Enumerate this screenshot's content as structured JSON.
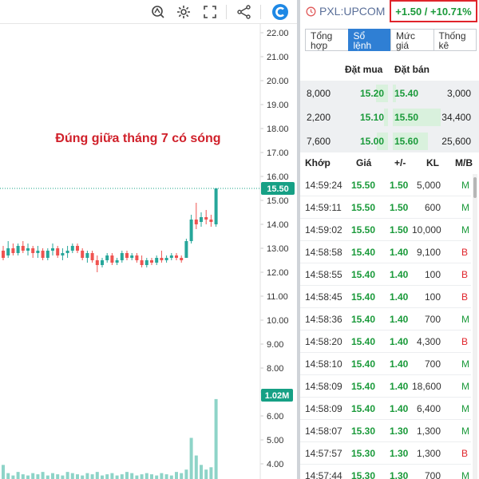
{
  "toolbar": {
    "icons": [
      "compare-icon",
      "settings-icon",
      "fullscreen-icon",
      "share-icon",
      "app-logo-icon"
    ]
  },
  "chart": {
    "annotation": "Đúng giữa tháng 7 có sóng",
    "annotation_color": "#d0202a",
    "last_price_label": "15.50",
    "volume_label": "1.02M",
    "up_color": "#26a69a",
    "down_color": "#ef5350",
    "volume_color": "#8ed4c8",
    "label_color": "#16a085"
  },
  "chart_data": {
    "type": "candlestick",
    "price_axis_ticks": [
      "22.00",
      "21.00",
      "20.00",
      "19.00",
      "18.00",
      "17.00",
      "16.00",
      "15.00",
      "14.00",
      "13.00",
      "12.00",
      "11.00",
      "10.00",
      "9.00",
      "8.00",
      "7.00",
      "6.00",
      "5.00",
      "4.00"
    ],
    "price_range": [
      3.6,
      22.4
    ],
    "last_price": 15.5,
    "candles": [
      {
        "o": 12.9,
        "h": 13.1,
        "l": 12.5,
        "c": 12.6
      },
      {
        "o": 12.7,
        "h": 13.3,
        "l": 12.6,
        "c": 13.0
      },
      {
        "o": 13.0,
        "h": 13.2,
        "l": 12.7,
        "c": 12.8
      },
      {
        "o": 12.8,
        "h": 13.2,
        "l": 12.7,
        "c": 13.1
      },
      {
        "o": 13.1,
        "h": 13.3,
        "l": 12.8,
        "c": 12.9
      },
      {
        "o": 12.9,
        "h": 13.2,
        "l": 12.7,
        "c": 13.0
      },
      {
        "o": 13.0,
        "h": 13.1,
        "l": 12.6,
        "c": 12.8
      },
      {
        "o": 12.8,
        "h": 13.1,
        "l": 12.6,
        "c": 12.9
      },
      {
        "o": 12.9,
        "h": 13.0,
        "l": 12.5,
        "c": 12.6
      },
      {
        "o": 12.6,
        "h": 13.0,
        "l": 12.5,
        "c": 12.9
      },
      {
        "o": 12.9,
        "h": 13.2,
        "l": 12.7,
        "c": 13.0
      },
      {
        "o": 13.0,
        "h": 13.1,
        "l": 12.6,
        "c": 12.7
      },
      {
        "o": 12.7,
        "h": 13.0,
        "l": 12.5,
        "c": 12.8
      },
      {
        "o": 12.8,
        "h": 13.1,
        "l": 12.6,
        "c": 12.9
      },
      {
        "o": 12.9,
        "h": 13.2,
        "l": 12.8,
        "c": 13.1
      },
      {
        "o": 13.1,
        "h": 13.2,
        "l": 12.8,
        "c": 12.9
      },
      {
        "o": 12.9,
        "h": 13.0,
        "l": 12.5,
        "c": 12.6
      },
      {
        "o": 12.6,
        "h": 12.9,
        "l": 12.4,
        "c": 12.8
      },
      {
        "o": 12.8,
        "h": 12.9,
        "l": 12.4,
        "c": 12.5
      },
      {
        "o": 12.5,
        "h": 12.7,
        "l": 12.0,
        "c": 12.3
      },
      {
        "o": 12.3,
        "h": 12.6,
        "l": 12.2,
        "c": 12.5
      },
      {
        "o": 12.5,
        "h": 12.8,
        "l": 12.4,
        "c": 12.7
      },
      {
        "o": 12.7,
        "h": 12.8,
        "l": 12.3,
        "c": 12.4
      },
      {
        "o": 12.4,
        "h": 12.6,
        "l": 12.3,
        "c": 12.5
      },
      {
        "o": 12.5,
        "h": 12.9,
        "l": 12.4,
        "c": 12.8
      },
      {
        "o": 12.8,
        "h": 12.9,
        "l": 12.5,
        "c": 12.6
      },
      {
        "o": 12.6,
        "h": 12.8,
        "l": 12.5,
        "c": 12.7
      },
      {
        "o": 12.7,
        "h": 12.8,
        "l": 12.4,
        "c": 12.5
      },
      {
        "o": 12.5,
        "h": 12.7,
        "l": 12.2,
        "c": 12.3
      },
      {
        "o": 12.3,
        "h": 12.6,
        "l": 12.2,
        "c": 12.5
      },
      {
        "o": 12.5,
        "h": 12.6,
        "l": 12.3,
        "c": 12.4
      },
      {
        "o": 12.4,
        "h": 12.7,
        "l": 12.3,
        "c": 12.6
      },
      {
        "o": 12.6,
        "h": 12.9,
        "l": 12.4,
        "c": 12.5
      },
      {
        "o": 12.5,
        "h": 12.7,
        "l": 12.4,
        "c": 12.6
      },
      {
        "o": 12.6,
        "h": 12.8,
        "l": 12.5,
        "c": 12.7
      },
      {
        "o": 12.7,
        "h": 12.8,
        "l": 12.5,
        "c": 12.6
      },
      {
        "o": 12.6,
        "h": 12.7,
        "l": 12.4,
        "c": 12.5
      },
      {
        "o": 12.6,
        "h": 13.4,
        "l": 12.6,
        "c": 13.3
      },
      {
        "o": 13.3,
        "h": 14.4,
        "l": 13.2,
        "c": 14.2
      },
      {
        "o": 14.2,
        "h": 14.9,
        "l": 13.8,
        "c": 14.0
      },
      {
        "o": 14.1,
        "h": 14.5,
        "l": 13.9,
        "c": 14.3
      },
      {
        "o": 14.3,
        "h": 14.6,
        "l": 14.0,
        "c": 14.2
      },
      {
        "o": 14.2,
        "h": 14.4,
        "l": 13.9,
        "c": 14.1
      },
      {
        "o": 14.0,
        "h": 15.5,
        "l": 13.9,
        "c": 15.5
      }
    ],
    "volume_axis_ticks": [
      "7.00",
      "6.00",
      "5.00",
      "4.00"
    ],
    "volumes": [
      0.12,
      0.05,
      0.03,
      0.06,
      0.04,
      0.03,
      0.05,
      0.04,
      0.06,
      0.03,
      0.05,
      0.04,
      0.03,
      0.06,
      0.05,
      0.04,
      0.03,
      0.05,
      0.04,
      0.06,
      0.03,
      0.04,
      0.05,
      0.03,
      0.04,
      0.06,
      0.05,
      0.03,
      0.04,
      0.05,
      0.04,
      0.03,
      0.05,
      0.04,
      0.03,
      0.06,
      0.05,
      0.08,
      0.35,
      0.2,
      0.12,
      0.08,
      0.1,
      0.68
    ],
    "volume_range": [
      0,
      0.72
    ]
  },
  "order_panel": {
    "symbol": "PXL:UPCOM",
    "change": "+1.50 / +10.71%",
    "tabs": [
      {
        "line1": "Tổng",
        "line2": "hợp",
        "active": false
      },
      {
        "line1": "Sổ",
        "line2": "lệnh",
        "active": true
      },
      {
        "line1": "Mức",
        "line2": "giá",
        "active": false
      },
      {
        "line1": "Thống",
        "line2": "kê",
        "active": false
      }
    ],
    "book_header": {
      "buy": "Đặt mua",
      "sell": "Đặt bán"
    },
    "book": [
      {
        "buy_vol": "8,000",
        "buy_price": "15.20",
        "sell_price": "15.40",
        "sell_vol": "3,000",
        "buy_level": 0.25,
        "sell_level": 0.06
      },
      {
        "buy_vol": "2,200",
        "buy_price": "15.10",
        "sell_price": "15.50",
        "sell_vol": "34,400",
        "buy_level": 0.08,
        "sell_level": 1.0
      },
      {
        "buy_vol": "7,600",
        "buy_price": "15.00",
        "sell_price": "15.60",
        "sell_vol": "25,600",
        "buy_level": 0.23,
        "sell_level": 0.74
      }
    ],
    "trades_header": {
      "time": "Khớp",
      "price": "Giá",
      "change": "+/-",
      "volume": "KL",
      "side": "M/B"
    },
    "trades": [
      {
        "time": "14:59:24",
        "price": "15.50",
        "change": "1.50",
        "volume": "5,000",
        "side": "M"
      },
      {
        "time": "14:59:11",
        "price": "15.50",
        "change": "1.50",
        "volume": "600",
        "side": "M"
      },
      {
        "time": "14:59:02",
        "price": "15.50",
        "change": "1.50",
        "volume": "10,000",
        "side": "M"
      },
      {
        "time": "14:58:58",
        "price": "15.40",
        "change": "1.40",
        "volume": "9,100",
        "side": "B"
      },
      {
        "time": "14:58:55",
        "price": "15.40",
        "change": "1.40",
        "volume": "100",
        "side": "B"
      },
      {
        "time": "14:58:45",
        "price": "15.40",
        "change": "1.40",
        "volume": "100",
        "side": "B"
      },
      {
        "time": "14:58:36",
        "price": "15.40",
        "change": "1.40",
        "volume": "700",
        "side": "M"
      },
      {
        "time": "14:58:20",
        "price": "15.40",
        "change": "1.40",
        "volume": "4,300",
        "side": "B"
      },
      {
        "time": "14:58:10",
        "price": "15.40",
        "change": "1.40",
        "volume": "700",
        "side": "M"
      },
      {
        "time": "14:58:09",
        "price": "15.40",
        "change": "1.40",
        "volume": "18,600",
        "side": "M"
      },
      {
        "time": "14:58:09",
        "price": "15.40",
        "change": "1.40",
        "volume": "6,400",
        "side": "M"
      },
      {
        "time": "14:58:07",
        "price": "15.30",
        "change": "1.30",
        "volume": "1,300",
        "side": "M"
      },
      {
        "time": "14:57:57",
        "price": "15.30",
        "change": "1.30",
        "volume": "1,300",
        "side": "B"
      },
      {
        "time": "14:57:44",
        "price": "15.30",
        "change": "1.30",
        "volume": "700",
        "side": "M"
      }
    ]
  }
}
